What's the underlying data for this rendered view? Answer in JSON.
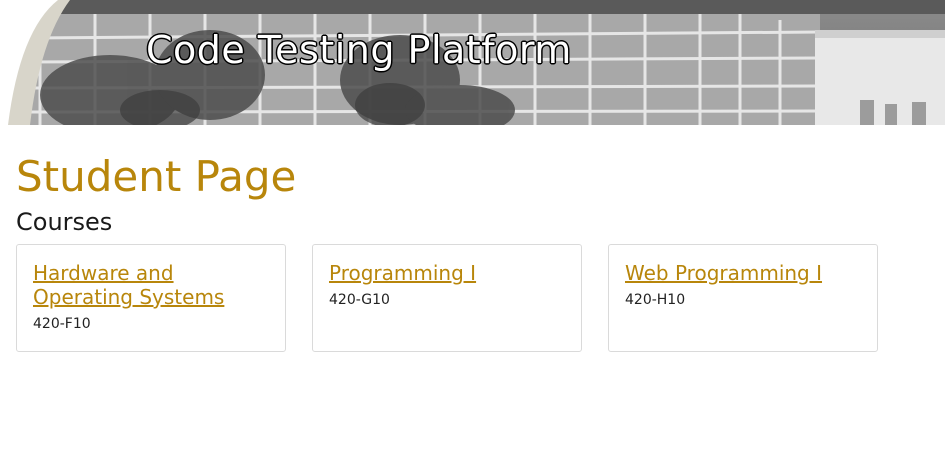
{
  "header": {
    "title": "Code Testing Platform"
  },
  "main": {
    "page_title": "Student Page",
    "section_title": "Courses",
    "courses": [
      {
        "name": "Hardware and Operating Systems",
        "code": "420-F10"
      },
      {
        "name": "Programming I",
        "code": "420-G10"
      },
      {
        "name": "Web Programming I",
        "code": "420-H10"
      }
    ]
  },
  "colors": {
    "accent": "#b8860b",
    "banner_gray": "#9a9a9a",
    "card_border": "#dadada"
  }
}
